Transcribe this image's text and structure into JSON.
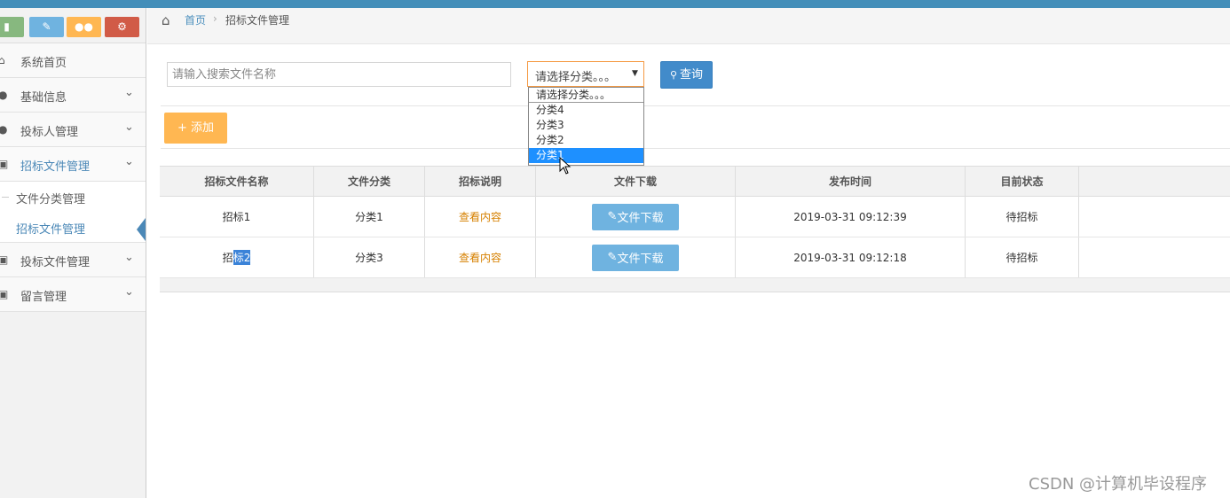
{
  "sidebar": {
    "shortcuts": [
      "signal-icon",
      "pencil-icon",
      "users-icon",
      "cogs-icon"
    ],
    "items": [
      {
        "label": "系统首页",
        "icon": "home-icon"
      },
      {
        "label": "基础信息",
        "icon": "user-icon"
      },
      {
        "label": "投标人管理",
        "icon": "user-icon"
      },
      {
        "label": "招标文件管理",
        "icon": "picture-icon"
      },
      {
        "label": "投标文件管理",
        "icon": "picture-icon"
      },
      {
        "label": "留言管理",
        "icon": "picture-icon"
      }
    ],
    "sub_items": [
      {
        "label": "文件分类管理"
      },
      {
        "label": "招标文件管理"
      }
    ]
  },
  "breadcrumb": {
    "home": "首页",
    "current": "招标文件管理"
  },
  "search": {
    "placeholder": "请输入搜索文件名称",
    "select_value": "请选择分类。。。",
    "query_label": "查询",
    "options": [
      "请选择分类。。。",
      "分类4",
      "分类3",
      "分类2",
      "分类1"
    ],
    "highlighted_option": "分类1"
  },
  "add_label": "添加",
  "table": {
    "headers": [
      "招标文件名称",
      "文件分类",
      "招标说明",
      "文件下载",
      "发布时间",
      "目前状态"
    ],
    "rows": [
      {
        "name": "招标1",
        "category": "分类1",
        "desc": "查看内容",
        "download": "文件下载",
        "time": "2019-03-31 09:12:39",
        "status": "待招标"
      },
      {
        "name_prefix": "招",
        "name_selected": "标2",
        "category": "分类3",
        "desc": "查看内容",
        "download": "文件下载",
        "time": "2019-03-31 09:12:18",
        "status": "待招标"
      }
    ]
  },
  "watermark": "CSDN @计算机毕设程序",
  "colors": {
    "topbar": "#438eb9",
    "add": "#ffb752",
    "query": "#428bca",
    "download": "#6fb3e0",
    "link": "#d68000"
  }
}
